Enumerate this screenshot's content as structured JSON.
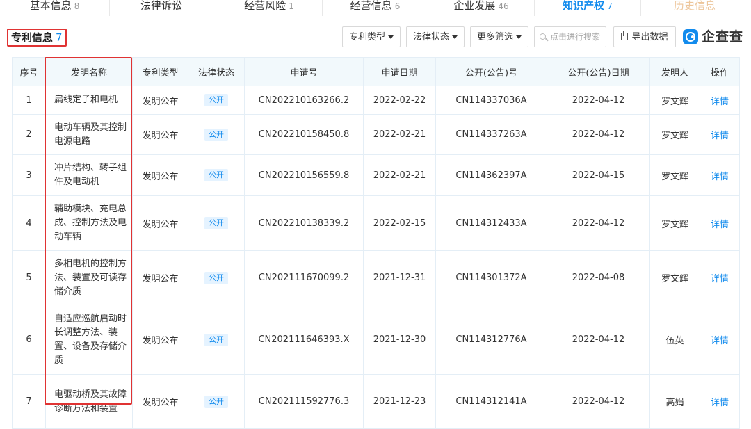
{
  "tabs": [
    {
      "label": "基本信息",
      "count": "8"
    },
    {
      "label": "法律诉讼",
      "count": ""
    },
    {
      "label": "经营风险",
      "count": "1"
    },
    {
      "label": "经营信息",
      "count": "6"
    },
    {
      "label": "企业发展",
      "count": "46"
    },
    {
      "label": "知识产权",
      "count": "7"
    },
    {
      "label": "历史信息",
      "count": ""
    }
  ],
  "section": {
    "title": "专利信息",
    "count": "7"
  },
  "filters": {
    "patent_type": "专利类型",
    "legal_status": "法律状态",
    "more_filters": "更多筛选",
    "search_placeholder": "点击进行搜索",
    "export": "导出数据"
  },
  "logo": {
    "text": "企查查"
  },
  "colors": {
    "accent": "#128bed",
    "highlight": "#e03333",
    "header_bg": "#f2f9fc"
  },
  "table": {
    "headers": [
      "序号",
      "发明名称",
      "专利类型",
      "法律状态",
      "申请号",
      "申请日期",
      "公开(公告)号",
      "公开(公告)日期",
      "发明人",
      "操作"
    ],
    "rows": [
      {
        "no": "1",
        "name": "扁线定子和电机",
        "type": "发明公布",
        "status": "公开",
        "app_no": "CN202210163266.2",
        "app_date": "2022-02-22",
        "pub_no": "CN114337036A",
        "pub_date": "2022-04-12",
        "inventor": "罗文辉",
        "action": "详情"
      },
      {
        "no": "2",
        "name": "电动车辆及其控制电源电路",
        "type": "发明公布",
        "status": "公开",
        "app_no": "CN202210158450.8",
        "app_date": "2022-02-21",
        "pub_no": "CN114337263A",
        "pub_date": "2022-04-12",
        "inventor": "罗文辉",
        "action": "详情"
      },
      {
        "no": "3",
        "name": "冲片结构、转子组件及电动机",
        "type": "发明公布",
        "status": "公开",
        "app_no": "CN202210156559.8",
        "app_date": "2022-02-21",
        "pub_no": "CN114362397A",
        "pub_date": "2022-04-15",
        "inventor": "罗文辉",
        "action": "详情"
      },
      {
        "no": "4",
        "name": "辅助模块、充电总成、控制方法及电动车辆",
        "type": "发明公布",
        "status": "公开",
        "app_no": "CN202210138339.2",
        "app_date": "2022-02-15",
        "pub_no": "CN114312433A",
        "pub_date": "2022-04-12",
        "inventor": "罗文辉",
        "action": "详情"
      },
      {
        "no": "5",
        "name": "多相电机的控制方法、装置及可读存储介质",
        "type": "发明公布",
        "status": "公开",
        "app_no": "CN202111670099.2",
        "app_date": "2021-12-31",
        "pub_no": "CN114301372A",
        "pub_date": "2022-04-08",
        "inventor": "罗文辉",
        "action": "详情"
      },
      {
        "no": "6",
        "name": "自适应巡航启动时长调整方法、装置、设备及存储介质",
        "type": "发明公布",
        "status": "公开",
        "app_no": "CN202111646393.X",
        "app_date": "2021-12-30",
        "pub_no": "CN114312776A",
        "pub_date": "2022-04-12",
        "inventor": "伍英",
        "action": "详情"
      },
      {
        "no": "7",
        "name": "电驱动桥及其故障诊断方法和装置",
        "type": "发明公布",
        "status": "公开",
        "app_no": "CN202111592776.3",
        "app_date": "2021-12-23",
        "pub_no": "CN114312141A",
        "pub_date": "2022-04-12",
        "inventor": "高娟",
        "action": "详情"
      }
    ]
  }
}
